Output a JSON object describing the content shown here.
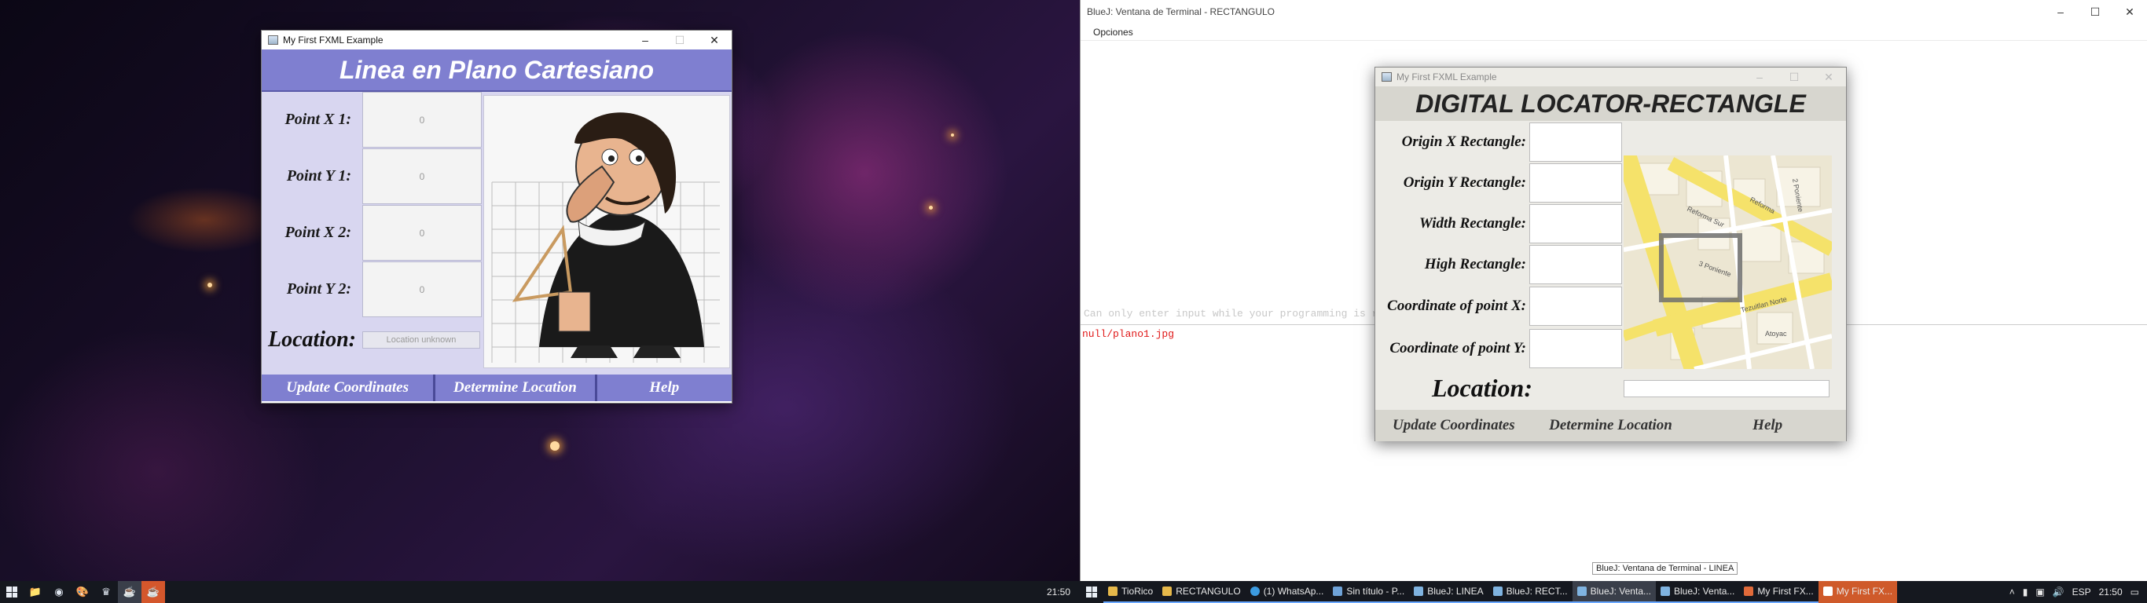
{
  "left": {
    "line_window": {
      "title": "My First FXML Example",
      "header": "Linea en Plano Cartesiano",
      "fields": [
        {
          "label": "Point X 1:",
          "value": "0"
        },
        {
          "label": "Point Y 1:",
          "value": "0"
        },
        {
          "label": "Point X 2:",
          "value": "0"
        },
        {
          "label": "Point Y 2:",
          "value": "0"
        }
      ],
      "location_label": "Location:",
      "location_placeholder": "Location unknown",
      "buttons": [
        "Update Coordinates",
        "Determine Location",
        "Help"
      ],
      "colors": {
        "header": "#7f7fd0",
        "body": "#d8d6f0"
      }
    },
    "taskbar": {
      "clock": "21:50"
    }
  },
  "right": {
    "terminal": {
      "title": "BlueJ: Ventana de Terminal - RECTANGULO",
      "menu": "Opciones",
      "input_hint": "Can only enter input while your programming is running",
      "output": "null/plano1.jpg",
      "tooltip": "BlueJ: Ventana de Terminal - LINEA"
    },
    "rect_window": {
      "title": "My First FXML Example",
      "header": "DIGITAL LOCATOR-RECTANGLE",
      "fields": [
        {
          "label": "Origin X Rectangle:"
        },
        {
          "label": "Origin Y Rectangle:"
        },
        {
          "label": "Width Rectangle:"
        },
        {
          "label": "High Rectangle:"
        },
        {
          "label": "Coordinate of point X:"
        },
        {
          "label": "Coordinate of point Y:"
        }
      ],
      "location_label": "Location:",
      "buttons": [
        "Update Coordinates",
        "Determine Location",
        "Help"
      ],
      "map_labels": [
        "Reforma",
        "Tezuitlan Norte",
        "Atoyac",
        "Reforma Sur",
        "2 Poniente",
        "3 Poniente"
      ]
    },
    "taskbar": {
      "tasks": [
        {
          "label": "TioRico",
          "icon": "folder-icon"
        },
        {
          "label": "RECTANGULO",
          "icon": "folder-icon"
        },
        {
          "label": "(1) WhatsAp...",
          "icon": "chrome-icon"
        },
        {
          "label": "Sin título - P...",
          "icon": "paint-icon"
        },
        {
          "label": "BlueJ: LINEA",
          "icon": "bluej-icon"
        },
        {
          "label": "BlueJ: RECT...",
          "icon": "bluej-icon"
        },
        {
          "label": "BlueJ: Venta...",
          "icon": "bluej-icon"
        },
        {
          "label": "BlueJ: Venta...",
          "icon": "bluej-icon"
        },
        {
          "label": "My First FX...",
          "icon": "java-icon"
        },
        {
          "label": "My First FX...",
          "icon": "java-icon"
        }
      ],
      "lang": "ESP",
      "clock": "21:50"
    }
  }
}
